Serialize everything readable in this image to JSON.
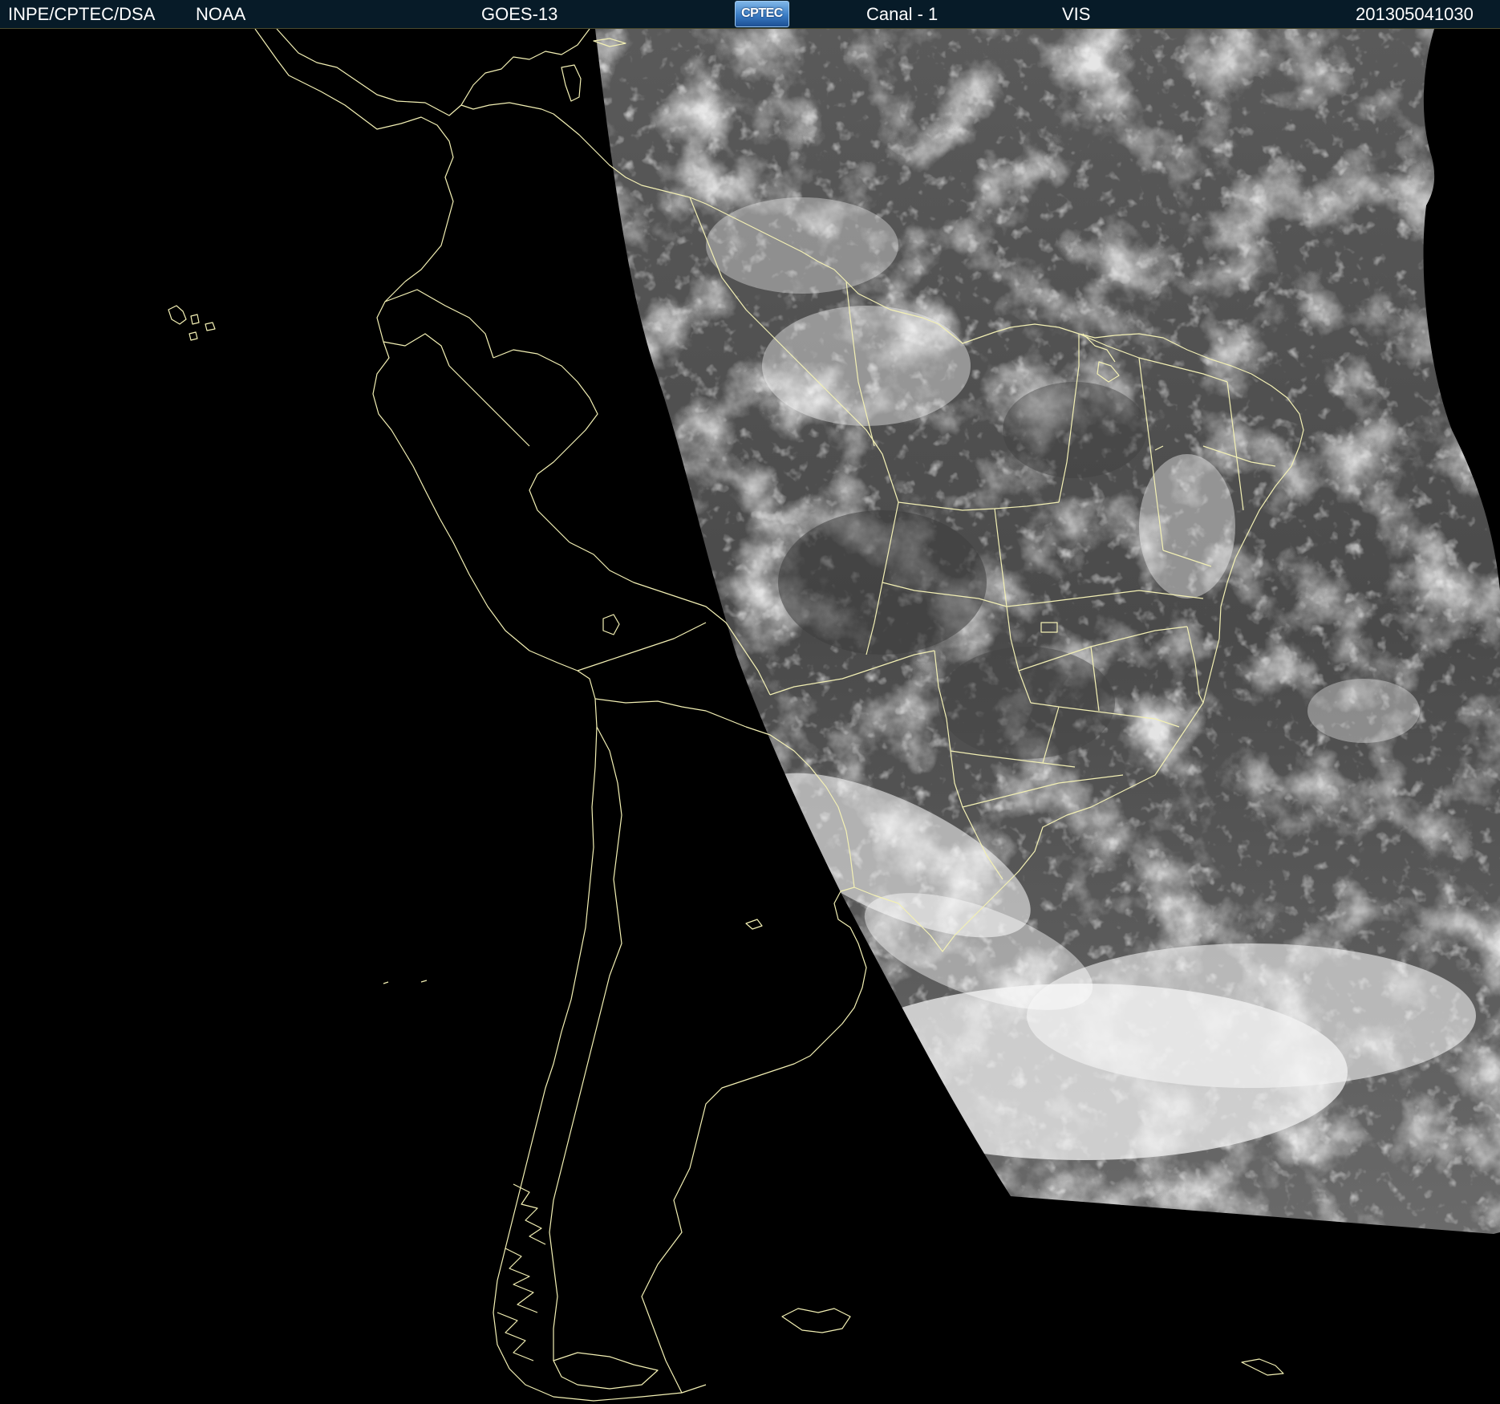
{
  "header": {
    "source": "INPE/CPTEC/DSA",
    "agency": "NOAA",
    "satellite": "GOES-13",
    "logo_text": "CPTEC",
    "channel": "Canal - 1",
    "band": "VIS",
    "timestamp": "201305041030"
  },
  "colors": {
    "header_bg": "#071b28",
    "border_lines": "#f3f0b4",
    "space": "#000000"
  },
  "icons": {
    "logo": "cptec-logo-icon"
  }
}
